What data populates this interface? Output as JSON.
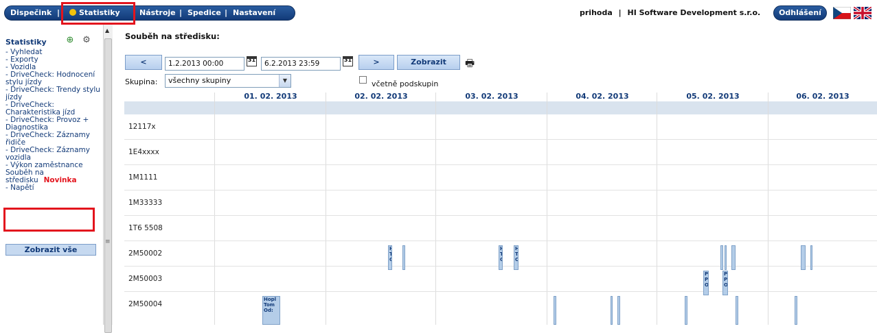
{
  "topnav": {
    "items": [
      {
        "label": "Dispečink"
      },
      {
        "label": "Statistiky"
      },
      {
        "label": "Nástroje"
      },
      {
        "label": "Spedice"
      },
      {
        "label": "Nastavení"
      }
    ],
    "separator": "|",
    "user": "prihoda",
    "company": "HI Software Development s.r.o.",
    "logout_label": "Odhlášení"
  },
  "sidebar": {
    "title": "Statistiky",
    "items": [
      {
        "label": "- Vyhledat"
      },
      {
        "label": "- Exporty"
      },
      {
        "label": "- Vozidla"
      },
      {
        "label": "- DriveCheck: Hodnocení stylu jízdy"
      },
      {
        "label": "- DriveCheck: Trendy stylu jízdy"
      },
      {
        "label": "- DriveCheck: Charakteristika jízd"
      },
      {
        "label": "- DriveCheck: Provoz + Diagnostika"
      },
      {
        "label": "- DriveCheck: Záznamy řidiče"
      },
      {
        "label": "- DriveCheck: Záznamy vozidla"
      },
      {
        "label": "- Výkon zaměstnance"
      },
      {
        "label": "Souběh na středisku",
        "badge": "Novinka"
      },
      {
        "label": "- Napětí"
      }
    ],
    "show_all_label": "Zobrazit vše"
  },
  "main": {
    "title": "Souběh na středisku:",
    "prev_label": "<",
    "next_label": ">",
    "date_from": "1.2.2013 00:00",
    "date_to": "6.2.2013 23:59",
    "calendar_day": "31",
    "show_label": "Zobrazit",
    "group_label": "Skupina:",
    "group_value": "všechny skupiny",
    "subgroups_label": "včetně podskupin"
  },
  "grid": {
    "days": [
      "01. 02. 2013",
      "02. 02. 2013",
      "03. 02. 2013",
      "04. 02. 2013",
      "05. 02. 2013",
      "06. 02. 2013"
    ],
    "vehicles": [
      "12117x",
      "1E4xxxx",
      "1M1111",
      "1M33333",
      "1T6 5508",
      "2M50002",
      "2M50003",
      "2M50004"
    ],
    "events": {
      "e1": "H T C",
      "e2": "H T C",
      "e3": "H T C",
      "e4": "P P O",
      "e5": "P P O",
      "e6": "Hopl Tom Od:"
    }
  },
  "colors": {
    "nav_blue": "#123a78",
    "highlight_red": "#e3141d",
    "header_bg": "#d9e3ee",
    "event_fill": "#b4cde8"
  }
}
